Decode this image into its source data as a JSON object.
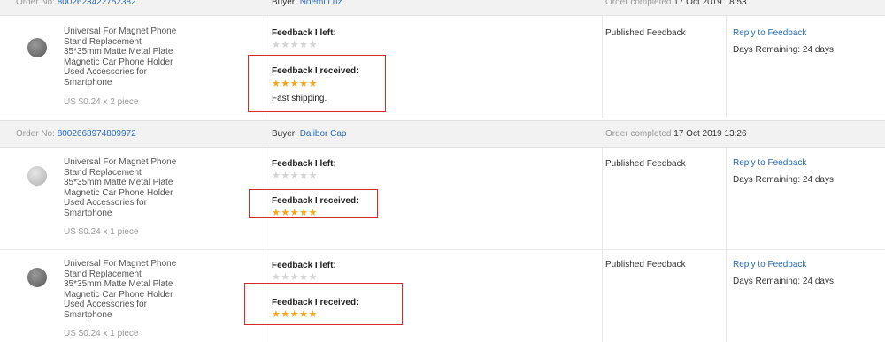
{
  "orders": [
    {
      "order_label": "Order No:",
      "order_no": "8002623422752382",
      "buyer_label": "Buyer:",
      "buyer": "Noemi Luz",
      "completed_label": "Order completed",
      "completed_at": "17 Oct 2019 18:53",
      "items": [
        {
          "title": "Universal For Magnet Phone Stand Replacement 35*35mm Matte Metal Plate Magnetic Car Phone Holder Used Accessories for Smartphone",
          "price": "US $0.24 x 2 piece",
          "feedback_left_label": "Feedback I left:",
          "feedback_left_stars": 0,
          "feedback_received_label": "Feedback I received:",
          "feedback_received_stars": 5,
          "feedback_comment": "Fast shipping.",
          "status": "Published Feedback",
          "reply_label": "Reply to Feedback",
          "days_remaining": "Days Remaining: 24 days"
        }
      ]
    },
    {
      "order_label": "Order No:",
      "order_no": "8002668974809972",
      "buyer_label": "Buyer:",
      "buyer": "Dalibor Cap",
      "completed_label": "Order completed",
      "completed_at": "17 Oct 2019 13:26",
      "items": [
        {
          "title": "Universal For Magnet Phone Stand Replacement 35*35mm Matte Metal Plate Magnetic Car Phone Holder Used Accessories for Smartphone",
          "price": "US $0.24 x 1 piece",
          "feedback_left_label": "Feedback I left:",
          "feedback_left_stars": 0,
          "feedback_received_label": "Feedback I received:",
          "feedback_received_stars": 5,
          "status": "Published Feedback",
          "reply_label": "Reply to Feedback",
          "days_remaining": "Days Remaining: 24 days"
        },
        {
          "title": "Universal For Magnet Phone Stand Replacement 35*35mm Matte Metal Plate Magnetic Car Phone Holder Used Accessories for Smartphone",
          "price": "US $0.24 x 1 piece",
          "feedback_left_label": "Feedback I left:",
          "feedback_left_stars": 0,
          "feedback_received_label": "Feedback I received:",
          "feedback_received_stars": 5,
          "status": "Published Feedback",
          "reply_label": "Reply to Feedback",
          "days_remaining": "Days Remaining: 24 days"
        }
      ]
    }
  ],
  "colors": {
    "link": "#2a6bb5",
    "star_filled": "#f0a81a",
    "star_empty": "#d4d4d4",
    "highlight_box": "#d42a2a",
    "header_bg": "#f2f2f2"
  }
}
